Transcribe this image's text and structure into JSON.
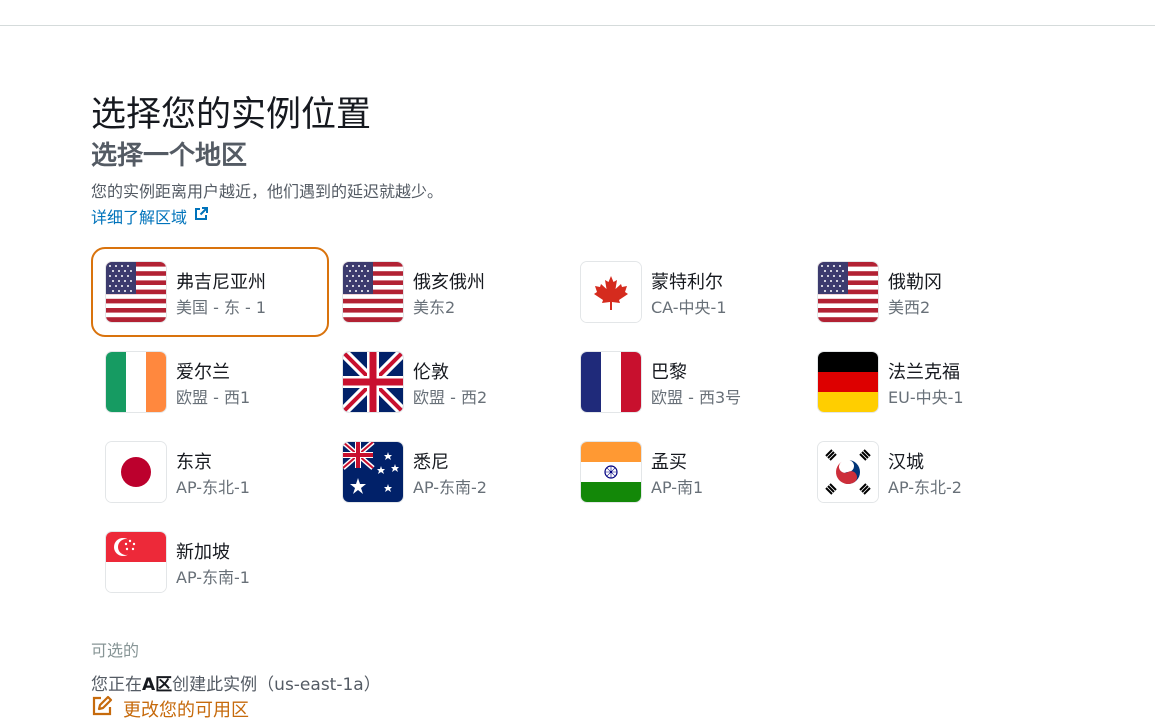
{
  "header": {
    "title": "选择您的实例位置",
    "subtitle": "选择一个地区",
    "description": "您的实例距离用户越近，他们遇到的延迟就越少。",
    "learn_more": "详细了解区域"
  },
  "regions": [
    {
      "name": "弗吉尼亚州",
      "code": "美国 - 东 - 1",
      "flag": "us-flag-icon",
      "selected": true
    },
    {
      "name": "俄亥俄州",
      "code": "美东2",
      "flag": "us-flag-icon"
    },
    {
      "name": "蒙特利尔",
      "code": "CA-中央-1",
      "flag": "canada-flag-icon"
    },
    {
      "name": "俄勒冈",
      "code": "美西2",
      "flag": "us-flag-icon"
    },
    {
      "name": "爱尔兰",
      "code": "欧盟 - 西1",
      "flag": "ireland-flag-icon"
    },
    {
      "name": "伦敦",
      "code": "欧盟 - 西2",
      "flag": "uk-flag-icon"
    },
    {
      "name": "巴黎",
      "code": "欧盟 - 西3号",
      "flag": "france-flag-icon"
    },
    {
      "name": "法兰克福",
      "code": "EU-中央-1",
      "flag": "germany-flag-icon"
    },
    {
      "name": "东京",
      "code": "AP-东北-1",
      "flag": "japan-flag-icon"
    },
    {
      "name": "悉尼",
      "code": "AP-东南-2",
      "flag": "australia-flag-icon"
    },
    {
      "name": "孟买",
      "code": "AP-南1",
      "flag": "india-flag-icon"
    },
    {
      "name": "汉城",
      "code": "AP-东北-2",
      "flag": "korea-flag-icon"
    },
    {
      "name": "新加坡",
      "code": "AP-东南-1",
      "flag": "singapore-flag-icon"
    }
  ],
  "availability_zone": {
    "optional_label": "可选的",
    "prefix": "您正在",
    "zone": "A区",
    "suffix": "创建此实例（us-east-1a）",
    "change_label": "更改您的可用区"
  },
  "colors": {
    "accent_orange": "#d9730d",
    "link_blue": "#0073bb",
    "text_dark": "#16191f",
    "text_muted": "#687078"
  }
}
